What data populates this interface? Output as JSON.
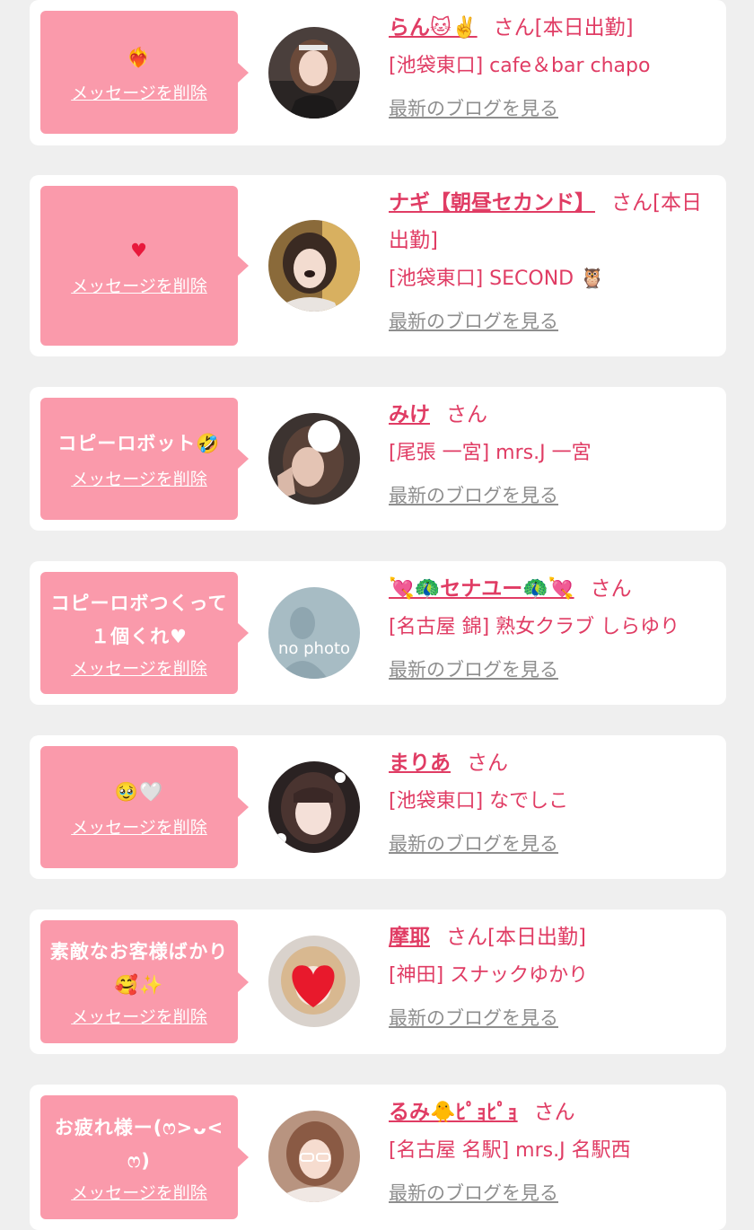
{
  "delete_label": "メッセージを削除",
  "blog_label": "最新のブログを見る",
  "colors": {
    "accent": "#e03c64",
    "bubble": "#fa9aab",
    "link_gray": "#8e8e8e",
    "background": "#efefef"
  },
  "messages": [
    {
      "message": "❤️‍🔥",
      "name": "らん🐱✌️",
      "honorific": "さん[本日出勤]",
      "shop": "[池袋東口] cafe＆bar chapo",
      "avatar_icon": "profile-photo"
    },
    {
      "message": "♥",
      "name": "ナギ【朝昼セカンド】",
      "honorific": "さん[本日出勤]",
      "shop": "[池袋東口] SECOND 🦉",
      "avatar_icon": "profile-photo"
    },
    {
      "message": "コピーロボット🤣",
      "name": "みけ",
      "honorific": "さん",
      "shop": "[尾張 一宮] mrs.J 一宮",
      "avatar_icon": "profile-photo"
    },
    {
      "message": "コピーロボつくって１個くれ♥",
      "name": "💘🦚セナユー🦚💘",
      "honorific": "さん",
      "shop": "[名古屋 錦] 熟女クラブ しらゆり",
      "avatar_icon": "no-photo",
      "avatar_text": "no photo"
    },
    {
      "message": "🥹🤍",
      "name": "まりあ",
      "honorific": "さん",
      "shop": "[池袋東口] なでしこ",
      "avatar_icon": "profile-photo"
    },
    {
      "message": "素敵なお客様ばかり🥰✨",
      "name": "摩耶",
      "honorific": "さん[本日出勤]",
      "shop": "[神田] スナックゆかり",
      "avatar_icon": "profile-photo"
    },
    {
      "message": "お疲れ様ー(ෆ>ᴗ<ෆ)",
      "name": "るみ🐥ﾋﾟｮﾋﾟｮ",
      "honorific": "さん",
      "shop": "[名古屋 名駅] mrs.J 名駅西",
      "avatar_icon": "profile-photo"
    }
  ]
}
